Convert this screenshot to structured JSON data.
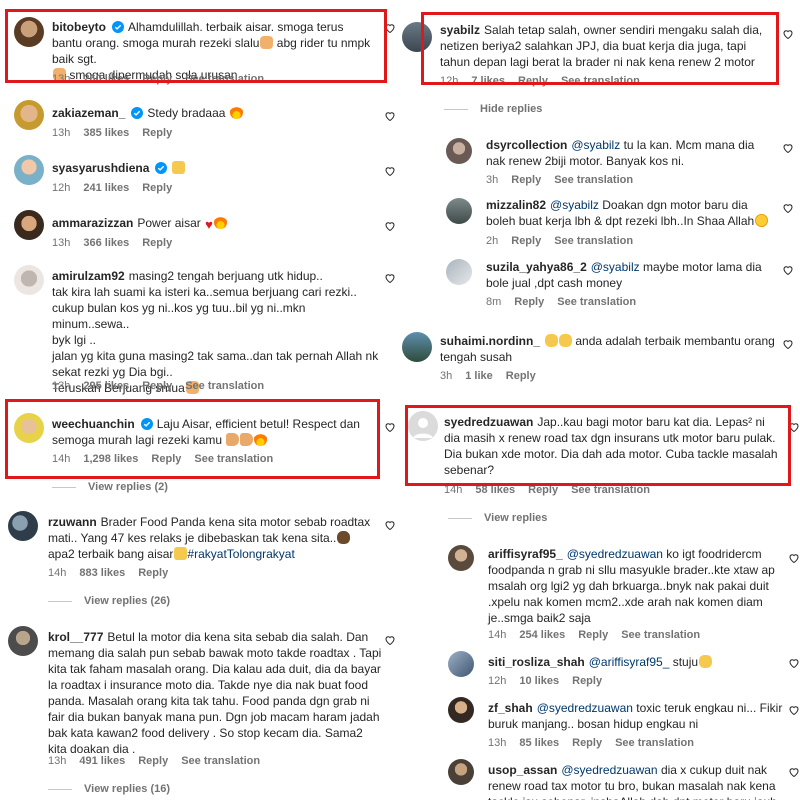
{
  "left": [
    {
      "user": "bitobeyto",
      "verified": true,
      "text": "Alhamdulillah. terbaik aisar. smoga terus bantu orang. smoga murah rezeki slalu",
      "emoji1": "folded-hands",
      "text2": " abg rider tu nmpk baik sgt.",
      "emoji2": "folded-hands",
      "text3": " smoga dipermudah sgla urusan",
      "time": "13h",
      "likes": "260 likes",
      "reply": "Reply",
      "translate": "See translation"
    },
    {
      "user": "zakiazeman_",
      "verified": true,
      "text": "Stedy bradaaa",
      "emoji1": "fire",
      "time": "13h",
      "likes": "385 likes",
      "reply": "Reply"
    },
    {
      "user": "syasyarushdiena",
      "verified": true,
      "text": "",
      "emoji1": "thumbs-up",
      "time": "12h",
      "likes": "241 likes",
      "reply": "Reply"
    },
    {
      "user": "ammarazizzan",
      "verified": false,
      "text": "Power aisar",
      "emoji1": "red-heart",
      "emoji2": "fire",
      "time": "13h",
      "likes": "366 likes",
      "reply": "Reply"
    },
    {
      "user": "amirulzam92",
      "verified": false,
      "text": "masing2 tengah berjuang utk hidup..",
      "lines": [
        "tak kira lah suami ka isteri ka..semua berjuang cari rezki..",
        "cukup bulan kos yg ni..kos yg tuu..bil yg ni..mkn minum..sewa..",
        "byk lgi ..",
        "jalan yg kita guna masing2 tak sama..dan tak pernah Allah nk",
        "sekat rezki yg Dia bgi..",
        "Teruskan Berjuang smua"
      ],
      "emoji_end": "folded-hands",
      "time": "13h",
      "likes": "295 likes",
      "reply": "Reply",
      "translate": "See translation"
    },
    {
      "user": "weechuanchin",
      "verified": true,
      "text": "Laju Aisar, efficient betul! Respect dan semoga murah lagi rezeki kamu",
      "emoji1": "muscle",
      "emoji2": "muscle",
      "emoji3": "fire",
      "time": "14h",
      "likes": "1,298 likes",
      "reply": "Reply",
      "translate": "See translation",
      "view_replies": "View replies (2)"
    },
    {
      "user": "rzuwann",
      "verified": false,
      "text": "Brader Food Panda kena sita motor sebab roadtax mati.. Yang 47 kes relaks je dibebaskan tak kena sita..",
      "emoji1": "pile-of-poo",
      "text2": " apa2 terbaik bang aisar",
      "emoji2": "thumbs-up",
      "hashtag": "#rakyatTolongrakyat",
      "time": "14h",
      "likes": "883 likes",
      "reply": "Reply",
      "view_replies": "View replies (26)"
    },
    {
      "user": "krol__777",
      "verified": false,
      "text": "Betul la motor dia kena sita sebab dia salah. Dan memang dia salah pun sebab bawak moto takde roadtax . Tapi kita tak faham masalah orang. Dia kalau ada duit, dia da bayar la roadtax i insurance moto dia. Takde nye dia nak buat food panda. Masalah orang kita tak tahu. Food panda dgn grab ni fair dia bukan banyak mana pun. Dgn job macam haram jadah bak kata kawan2 food delivery . So stop kecam dia. Sama2 kita doakan dia .",
      "time": "13h",
      "likes": "491 likes",
      "reply": "Reply",
      "translate": "See translation",
      "view_replies": "View replies (16)"
    }
  ],
  "right": [
    {
      "user": "syabilz",
      "text": "Salah tetap salah, owner sendiri mengaku salah dia, netizen beriya2 salahkan JPJ, dia buat kerja dia juga, tapi tahun depan lagi berat la brader ni nak kena renew 2 motor",
      "time": "12h",
      "likes": "7 likes",
      "reply": "Reply",
      "translate": "See translation",
      "hide_replies": "Hide replies"
    },
    {
      "user": "dsyrcollection",
      "mention": "@syabilz",
      "text": " tu la kan. Mcm mana dia nak renew 2biji motor. Banyak kos ni.",
      "time": "3h",
      "reply": "Reply",
      "translate": "See translation"
    },
    {
      "user": "mizzalin82",
      "mention": "@syabilz",
      "text": " Doakan dgn motor baru dia boleh buat kerja lbh & dpt rezeki lbh..In Shaa Allah",
      "emoji1": "smiling-face",
      "time": "2h",
      "reply": "Reply",
      "translate": "See translation"
    },
    {
      "user": "suzila_yahya86_2",
      "mention": "@syabilz",
      "text": " maybe motor lama dia bole jual ,dpt cash money",
      "time": "8m",
      "reply": "Reply",
      "translate": "See translation"
    },
    {
      "user": "suhaimi.nordinn_",
      "text": " anda adalah terbaik membantu orang tengah susah",
      "emoji1": "clapping-hands",
      "emoji2": "clapping-hands",
      "time": "3h",
      "likes": "1 like",
      "reply": "Reply"
    },
    {
      "user": "syedredzuawan",
      "text": "Jap..kau bagi motor baru kat dia. Lepas² ni dia masih x renew road tax dgn insurans utk motor baru pulak. Dia bukan xde motor. Dia dah ada motor. Cuba tackle masalah sebenar?",
      "time": "14h",
      "likes": "58 likes",
      "reply": "Reply",
      "translate": "See translation",
      "view_replies": "View replies"
    },
    {
      "user": "ariffisyraf95_",
      "mention": "@syedredzuawan",
      "text": " ko igt foodridercm foodpanda n grab ni sllu masyukle brader..kte xtaw ap msalah org lgi2 yg dah brkuarga..bnyk nak pakai duit .xpelu nak komen mcm2..xde arah nak komen diam je..smga baik2 saja",
      "time": "14h",
      "likes": "254 likes",
      "reply": "Reply",
      "translate": "See translation"
    },
    {
      "user": "siti_rosliza_shah",
      "mention": "@ariffisyraf95_",
      "text": " stuju",
      "emoji1": "clapping-hands",
      "time": "12h",
      "likes": "10 likes",
      "reply": "Reply"
    },
    {
      "user": "zf_shah",
      "mention": "@syedredzuawan",
      "text": " toxic teruk engkau ni... Fikir buruk manjang.. bosan hidup engkau ni",
      "time": "13h",
      "likes": "85 likes",
      "reply": "Reply",
      "translate": "See translation"
    },
    {
      "user": "usop_assan",
      "mention": "@syedredzuawan",
      "text": " dia x cukup duit nak renew road tax motor tu bro, bukan masalah nak kena tackle isu sebenar, inshaAllah dah dpt motor baru jauh",
      "time": "",
      "reply": ""
    }
  ],
  "colors": {
    "highlight": "#e0181b",
    "link": "#00376b",
    "meta": "#737373",
    "verified": "#0095f6"
  }
}
